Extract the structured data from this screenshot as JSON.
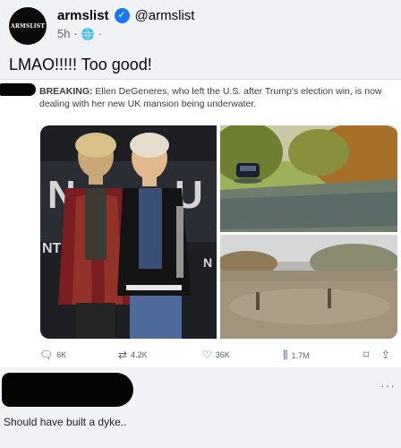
{
  "post": {
    "author_name": "armslist",
    "handle": "@armslist",
    "avatar_text": "ARMSLIST",
    "timestamp": "5h",
    "text": "LMAO!!!!! Too good!",
    "icons": {
      "verified": "verified-badge-icon",
      "audience": "globe-icon"
    }
  },
  "embedded_tweet": {
    "text_bold": "BREAKING:",
    "text_rest": "Ellen DeGeneres, who left the U.S. after Trump's election win, is now dealing with her new UK mansion being underwater.",
    "stats": {
      "replies": "6K",
      "reposts": "4.2K",
      "likes": "36K",
      "views": "1.7M"
    },
    "icons": [
      "reply-icon",
      "repost-icon",
      "like-icon",
      "views-icon",
      "bookmark-icon",
      "share-icon"
    ],
    "photo_backdrop_text": "NT"
  },
  "comment": {
    "text": "Should have built a dyke..",
    "more_label": "···"
  },
  "colors": {
    "verified_blue": "#1877f2",
    "meta_gray": "#65676b",
    "tweet_icon_gray": "#536471",
    "page_bg": "#f0f2f5"
  }
}
